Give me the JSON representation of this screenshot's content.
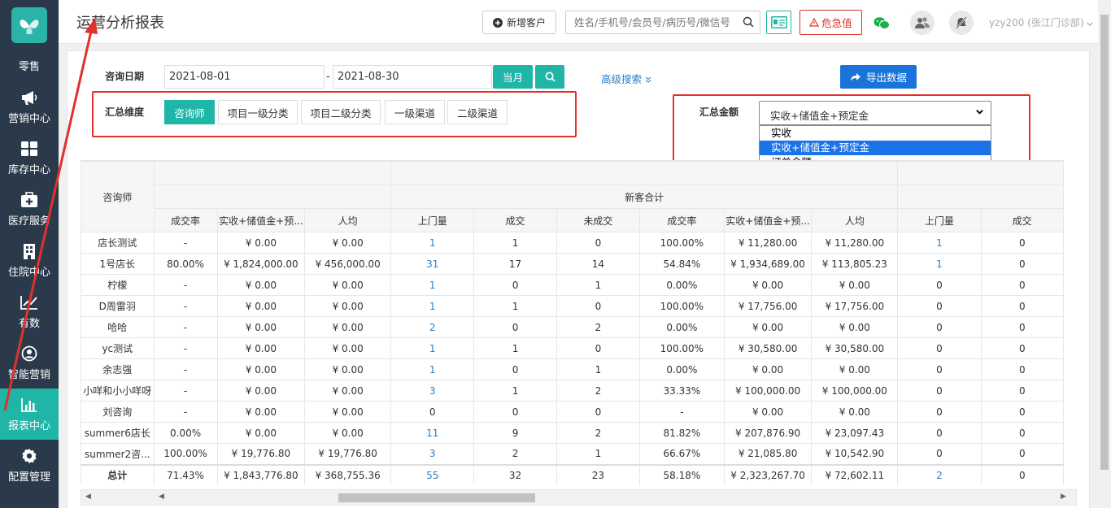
{
  "sidebar": {
    "items": [
      {
        "label": "零售",
        "icon": "retail-icon"
      },
      {
        "label": "营销中心",
        "icon": "megaphone-icon"
      },
      {
        "label": "库存中心",
        "icon": "grid-icon"
      },
      {
        "label": "医疗服务",
        "icon": "medical-kit-icon"
      },
      {
        "label": "住院中心",
        "icon": "building-icon"
      },
      {
        "label": "有数",
        "icon": "trend-chart-icon"
      },
      {
        "label": "智能营销",
        "icon": "smart-marketing-icon"
      },
      {
        "label": "报表中心",
        "icon": "bar-chart-icon",
        "active": true
      },
      {
        "label": "配置管理",
        "icon": "gear-icon"
      }
    ]
  },
  "header": {
    "title": "运营分析报表",
    "add_customer": "新增客户",
    "search_placeholder": "姓名/手机号/会员号/病历号/微信号",
    "danger_label": "危急值",
    "user": "yzy200 (张江门诊部)"
  },
  "filters": {
    "date_label": "咨询日期",
    "date_start": "2021-08-01",
    "date_sep": "-",
    "date_end": "2021-08-30",
    "month_btn": "当月",
    "advanced": "高级搜索",
    "export": "导出数据",
    "dim_label": "汇总维度",
    "dims": [
      "咨询师",
      "项目一级分类",
      "项目二级分类",
      "一级渠道",
      "二级渠道"
    ],
    "amount_label": "汇总金额",
    "amount_selected": "实收+储值金+预定金",
    "amount_options": [
      "实收",
      "实收+储值金+预定金",
      "订单金额"
    ]
  },
  "table": {
    "col_consultant": "咨询师",
    "group_new": "新客合计",
    "headers_left": [
      "成交率",
      "实收+储值金+预...",
      "人均"
    ],
    "headers_new": [
      "上门量",
      "成交",
      "未成交",
      "成交率",
      "实收+储值金+预...",
      "人均"
    ],
    "headers_right": [
      "上门量",
      "成交"
    ],
    "rows": [
      {
        "name": "店长测试",
        "c": [
          "-",
          "¥ 0.00",
          "¥ 0.00",
          "1",
          "1",
          "0",
          "100.00%",
          "¥ 11,280.00",
          "¥ 11,280.00",
          "1",
          "0"
        ]
      },
      {
        "name": "1号店长",
        "c": [
          "80.00%",
          "¥ 1,824,000.00",
          "¥ 456,000.00",
          "31",
          "17",
          "14",
          "54.84%",
          "¥ 1,934,689.00",
          "¥ 113,805.23",
          "1",
          "0"
        ]
      },
      {
        "name": "柠檬",
        "c": [
          "-",
          "¥ 0.00",
          "¥ 0.00",
          "1",
          "0",
          "1",
          "0.00%",
          "¥ 0.00",
          "¥ 0.00",
          "0",
          "0"
        ]
      },
      {
        "name": "D周雷羽",
        "c": [
          "-",
          "¥ 0.00",
          "¥ 0.00",
          "1",
          "1",
          "0",
          "100.00%",
          "¥ 17,756.00",
          "¥ 17,756.00",
          "0",
          "0"
        ]
      },
      {
        "name": "哈哈",
        "c": [
          "-",
          "¥ 0.00",
          "¥ 0.00",
          "2",
          "0",
          "2",
          "0.00%",
          "¥ 0.00",
          "¥ 0.00",
          "0",
          "0"
        ]
      },
      {
        "name": "yc测试",
        "c": [
          "-",
          "¥ 0.00",
          "¥ 0.00",
          "1",
          "1",
          "0",
          "100.00%",
          "¥ 30,580.00",
          "¥ 30,580.00",
          "0",
          "0"
        ]
      },
      {
        "name": "余志强",
        "c": [
          "-",
          "¥ 0.00",
          "¥ 0.00",
          "1",
          "0",
          "1",
          "0.00%",
          "¥ 0.00",
          "¥ 0.00",
          "0",
          "0"
        ]
      },
      {
        "name": "小咩和小小咩呀",
        "c": [
          "-",
          "¥ 0.00",
          "¥ 0.00",
          "3",
          "1",
          "2",
          "33.33%",
          "¥ 100,000.00",
          "¥ 100,000.00",
          "0",
          "0"
        ]
      },
      {
        "name": "刘咨询",
        "c": [
          "-",
          "¥ 0.00",
          "¥ 0.00",
          "0",
          "0",
          "0",
          "-",
          "¥ 0.00",
          "¥ 0.00",
          "0",
          "0"
        ]
      },
      {
        "name": "summer6店长",
        "c": [
          "0.00%",
          "¥ 0.00",
          "¥ 0.00",
          "11",
          "9",
          "2",
          "81.82%",
          "¥ 207,876.90",
          "¥ 23,097.43",
          "0",
          "0"
        ]
      },
      {
        "name": "summer2咨...",
        "c": [
          "100.00%",
          "¥ 19,776.80",
          "¥ 19,776.80",
          "3",
          "2",
          "1",
          "66.67%",
          "¥ 21,085.80",
          "¥ 10,542.90",
          "0",
          "0"
        ]
      }
    ],
    "total": {
      "name": "总计",
      "c": [
        "71.43%",
        "¥ 1,843,776.80",
        "¥ 368,755.36",
        "55",
        "32",
        "23",
        "58.18%",
        "¥ 2,323,267.70",
        "¥ 72,602.11",
        "2",
        "0"
      ]
    }
  },
  "colors": {
    "accent": "#1fb6a8",
    "sidebar": "#2b3a4a",
    "danger": "#d9352f",
    "link": "#2a7fc9",
    "annotation": "#e0312b"
  }
}
